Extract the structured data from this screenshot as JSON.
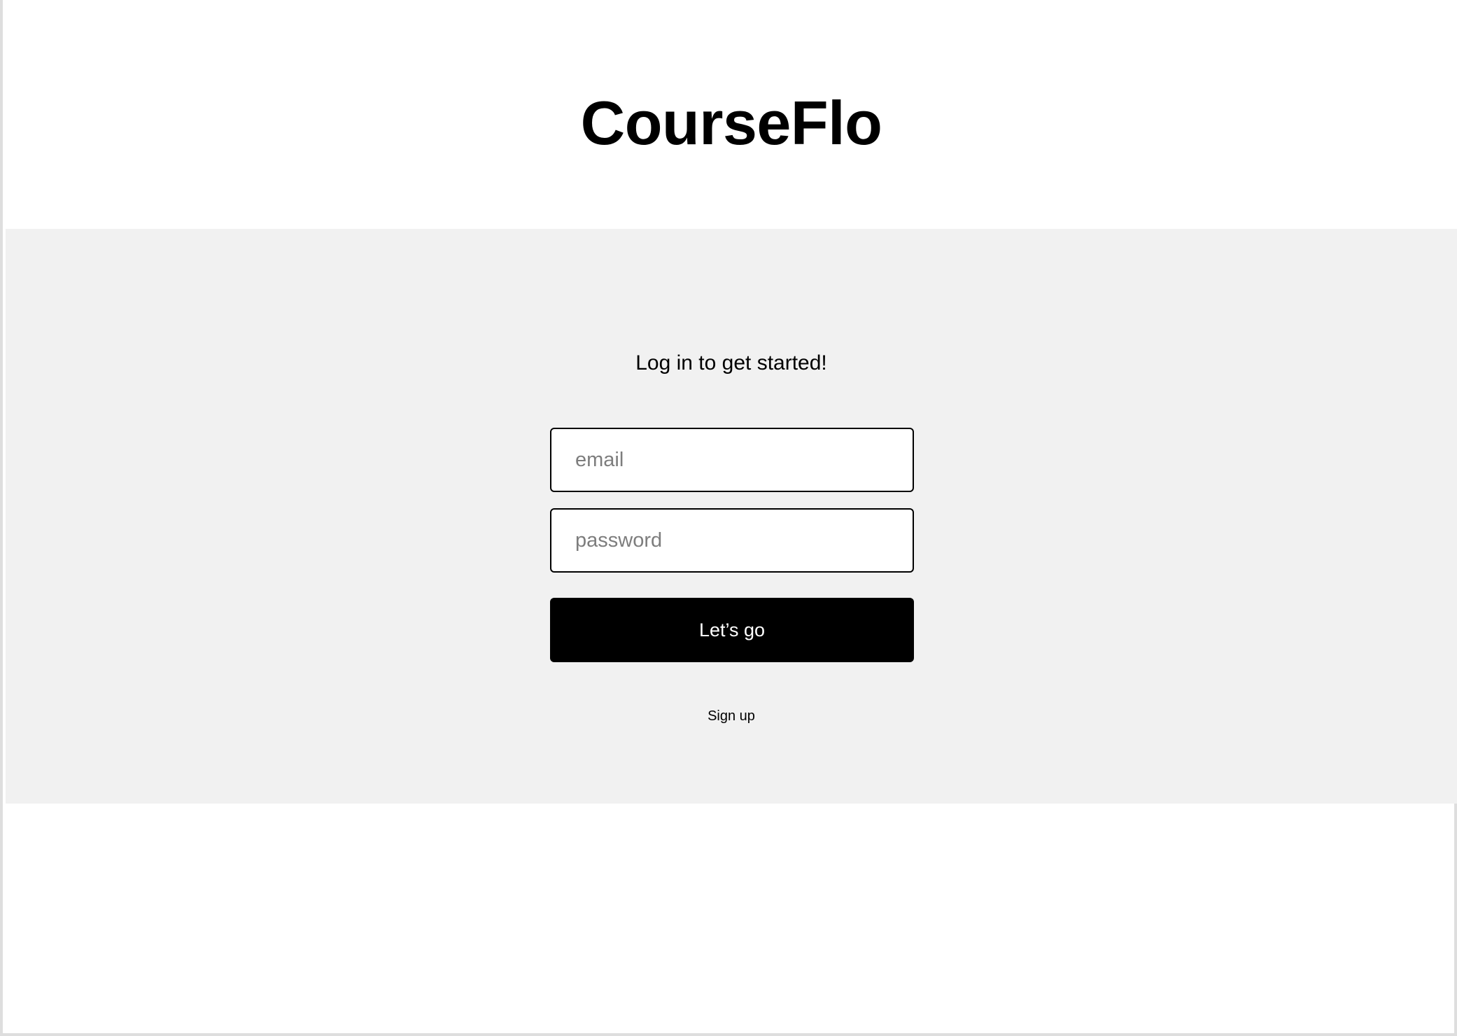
{
  "app": {
    "title": "CourseFlo"
  },
  "login": {
    "heading": "Log in to get started!",
    "email_placeholder": "email",
    "email_value": "",
    "password_placeholder": "password",
    "password_value": "",
    "submit_label": "Let’s go",
    "signup_label": "Sign up"
  },
  "colors": {
    "page_background": "#ffffff",
    "panel_background": "#f1f1f1",
    "button_background": "#000000",
    "button_text": "#ffffff",
    "placeholder_text": "#7d7d7d"
  }
}
